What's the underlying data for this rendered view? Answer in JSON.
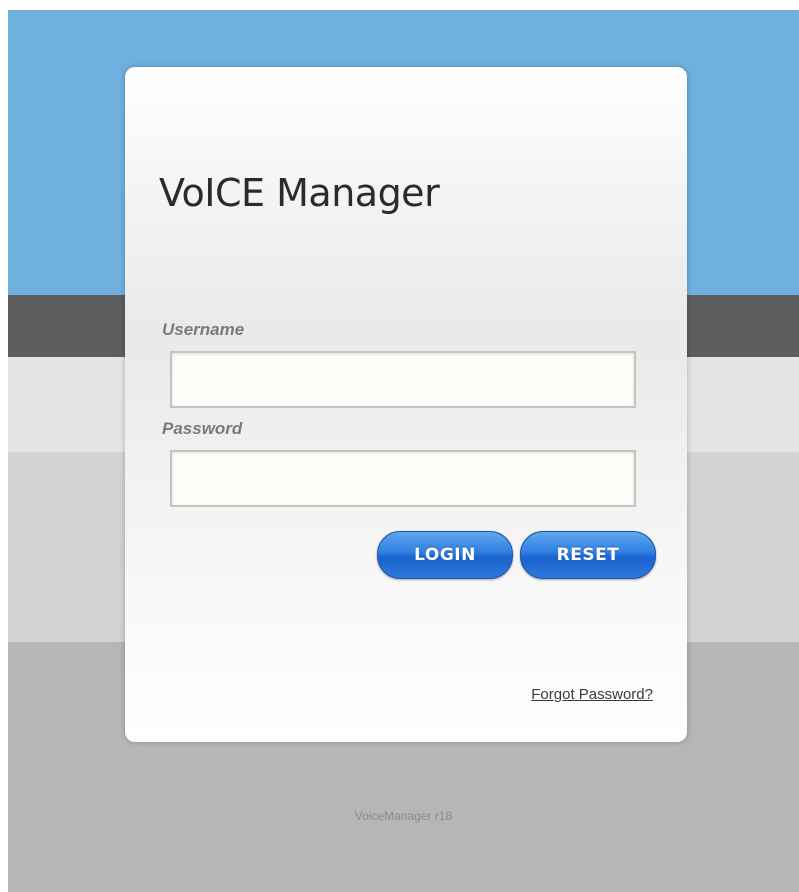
{
  "app": {
    "title": "VoICE Manager"
  },
  "login_form": {
    "username_label": "Username",
    "username_value": "",
    "password_label": "Password",
    "password_value": "",
    "login_button": "LOGIN",
    "reset_button": "RESET",
    "forgot_password_link": "Forgot Password?"
  },
  "footer": {
    "version_text": "VoiceManager r18"
  },
  "colors": {
    "header_blue": "#6fb0de",
    "button_blue": "#2f7de0",
    "dark_band": "#5e5e5e",
    "background_gray": "#b6b6b6"
  }
}
